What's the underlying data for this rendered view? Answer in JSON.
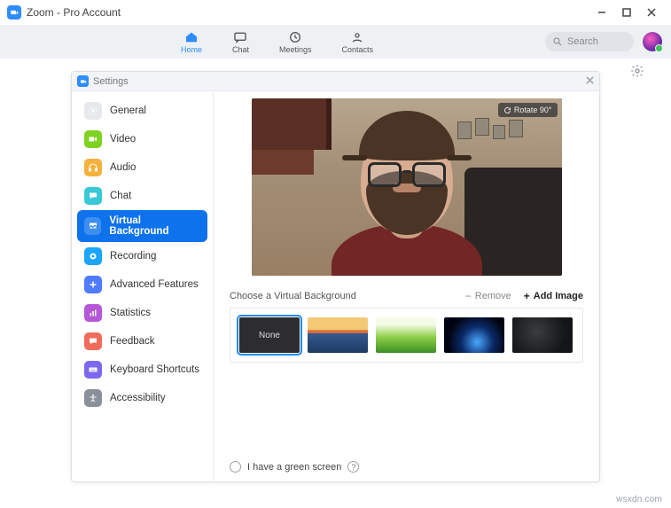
{
  "window": {
    "title": "Zoom - Pro Account"
  },
  "nav": {
    "home": "Home",
    "chat": "Chat",
    "meetings": "Meetings",
    "contacts": "Contacts",
    "search_placeholder": "Search"
  },
  "settings": {
    "title": "Settings",
    "sidebar": {
      "general": "General",
      "video": "Video",
      "audio": "Audio",
      "chat": "Chat",
      "virtual_bg": "Virtual Background",
      "recording": "Recording",
      "advanced": "Advanced Features",
      "statistics": "Statistics",
      "feedback": "Feedback",
      "keyboard": "Keyboard Shortcuts",
      "accessibility": "Accessibility"
    },
    "preview": {
      "rotate": "Rotate 90°"
    },
    "choose_label": "Choose a Virtual Background",
    "remove": "Remove",
    "add_image": "Add Image",
    "thumbs": {
      "none": "None"
    },
    "green_screen": "I have a green screen"
  },
  "colors": {
    "accent": "#0e72ed",
    "sidebar_icons": {
      "general": "#d0d3d8",
      "video": "#7ed321",
      "audio": "#f6b13c",
      "chat": "#38c8d6",
      "virtual_bg": "#0e72ed",
      "recording": "#1aa6ff",
      "advanced": "#4f7cff",
      "statistics": "#b557d6",
      "feedback": "#f06c5a",
      "keyboard": "#7b68ee",
      "accessibility": "#8a9099"
    }
  },
  "watermark": "wsxdn.com"
}
